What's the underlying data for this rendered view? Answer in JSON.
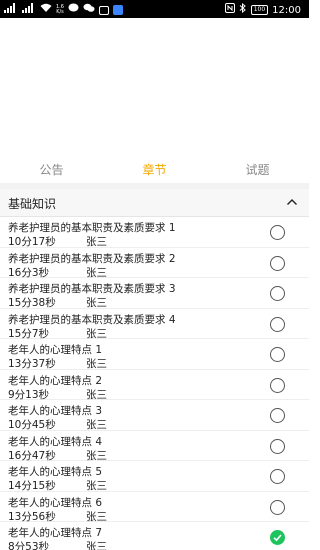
{
  "status_bar": {
    "net_speed": "1.6",
    "net_unit": "K/s",
    "battery": "100",
    "time": "12:00",
    "icons": [
      "signal-icon",
      "wifi-icon",
      "message-icon",
      "wechat-icon",
      "bluetooth-icon",
      "nfc-icon"
    ]
  },
  "tabs": [
    {
      "label": "公告",
      "active": false
    },
    {
      "label": "章节",
      "active": true
    },
    {
      "label": "试题",
      "active": false
    }
  ],
  "accent_color": "#f3a800",
  "check_color": "#1dc45e",
  "section": {
    "title": "基础知识",
    "expanded": true
  },
  "lessons": [
    {
      "title": "养老护理员的基本职责及素质要求 1",
      "duration": "10分17秒",
      "author": "张三",
      "checked": false
    },
    {
      "title": "养老护理员的基本职责及素质要求 2",
      "duration": "16分3秒",
      "author": "张三",
      "checked": false
    },
    {
      "title": "养老护理员的基本职责及素质要求 3",
      "duration": "15分38秒",
      "author": "张三",
      "checked": false
    },
    {
      "title": "养老护理员的基本职责及素质要求 4",
      "duration": "15分7秒",
      "author": "张三",
      "checked": false
    },
    {
      "title": "老年人的心理特点 1",
      "duration": "13分37秒",
      "author": "张三",
      "checked": false
    },
    {
      "title": "老年人的心理特点 2",
      "duration": "9分13秒",
      "author": "张三",
      "checked": false
    },
    {
      "title": "老年人的心理特点 3",
      "duration": "10分45秒",
      "author": "张三",
      "checked": false
    },
    {
      "title": "老年人的心理特点 4",
      "duration": "16分47秒",
      "author": "张三",
      "checked": false
    },
    {
      "title": "老年人的心理特点 5",
      "duration": "14分15秒",
      "author": "张三",
      "checked": false
    },
    {
      "title": "老年人的心理特点 6",
      "duration": "13分56秒",
      "author": "张三",
      "checked": false
    },
    {
      "title": "老年人的心理特点 7",
      "duration": "8分53秒",
      "author": "张三",
      "checked": true
    }
  ]
}
